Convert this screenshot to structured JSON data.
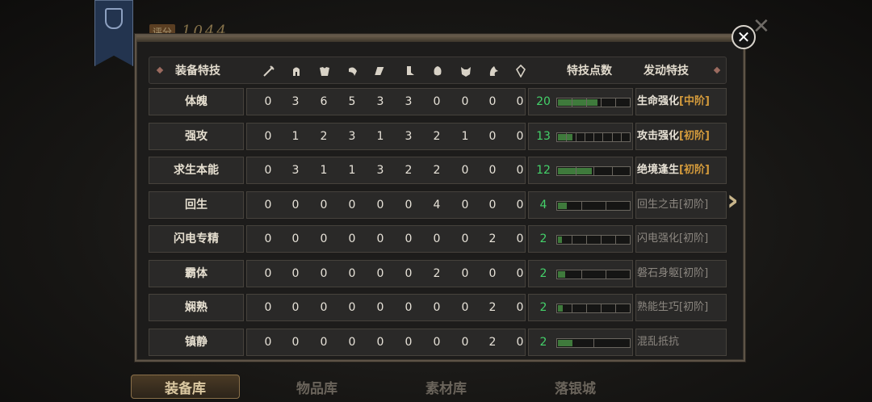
{
  "score": {
    "label": "评分",
    "value": "1044"
  },
  "header": {
    "col_trait": "装备特技",
    "col_points": "特技点数",
    "col_active": "发动特技",
    "slot_icons": [
      "sword-icon",
      "helmet-icon",
      "chest-armor-icon",
      "arm-armor-icon",
      "waist-armor-icon",
      "leg-armor-icon",
      "charm-icon",
      "mask-icon",
      "mount-icon",
      "gem-icon"
    ]
  },
  "rows": [
    {
      "name": "体魄",
      "values": [
        "0",
        "3",
        "6",
        "5",
        "3",
        "3",
        "0",
        "0",
        "0",
        "0"
      ],
      "points": "20",
      "fill": 0.56,
      "ticks": 4,
      "skill": "生命强化",
      "tier": "[中阶]",
      "dim": false
    },
    {
      "name": "强攻",
      "values": [
        "0",
        "1",
        "2",
        "3",
        "1",
        "3",
        "2",
        "1",
        "0",
        "0"
      ],
      "points": "13",
      "fill": 0.2,
      "ticks": 7,
      "skill": "攻击强化",
      "tier": "[初阶]",
      "dim": false
    },
    {
      "name": "求生本能",
      "values": [
        "0",
        "3",
        "1",
        "1",
        "3",
        "2",
        "2",
        "0",
        "0",
        "0"
      ],
      "points": "12",
      "fill": 0.48,
      "ticks": 3,
      "skill": "绝境逢生",
      "tier": "[初阶]",
      "dim": false
    },
    {
      "name": "回生",
      "values": [
        "0",
        "0",
        "0",
        "0",
        "0",
        "0",
        "4",
        "0",
        "0",
        "0"
      ],
      "points": "4",
      "fill": 0.12,
      "ticks": 2,
      "skill": "回生之击",
      "tier": "[初阶]",
      "dim": true
    },
    {
      "name": "闪电专精",
      "values": [
        "0",
        "0",
        "0",
        "0",
        "0",
        "0",
        "0",
        "0",
        "2",
        "0"
      ],
      "points": "2",
      "fill": 0.06,
      "ticks": 4,
      "skill": "闪电强化",
      "tier": "[初阶]",
      "dim": true
    },
    {
      "name": "霸体",
      "values": [
        "0",
        "0",
        "0",
        "0",
        "0",
        "0",
        "2",
        "0",
        "0",
        "0"
      ],
      "points": "2",
      "fill": 0.1,
      "ticks": 2,
      "skill": "磐石身躯",
      "tier": "[初阶]",
      "dim": true
    },
    {
      "name": "娴熟",
      "values": [
        "0",
        "0",
        "0",
        "0",
        "0",
        "0",
        "0",
        "0",
        "2",
        "0"
      ],
      "points": "2",
      "fill": 0.07,
      "ticks": 4,
      "skill": "熟能生巧",
      "tier": "[初阶]",
      "dim": true
    },
    {
      "name": "镇静",
      "values": [
        "0",
        "0",
        "0",
        "0",
        "0",
        "0",
        "0",
        "0",
        "2",
        "0"
      ],
      "points": "2",
      "fill": 0.2,
      "ticks": 1,
      "skill": "混乱抵抗",
      "tier": "",
      "dim": true
    }
  ],
  "tabs": [
    "装备库",
    "物品库",
    "素材库",
    "落银城"
  ]
}
